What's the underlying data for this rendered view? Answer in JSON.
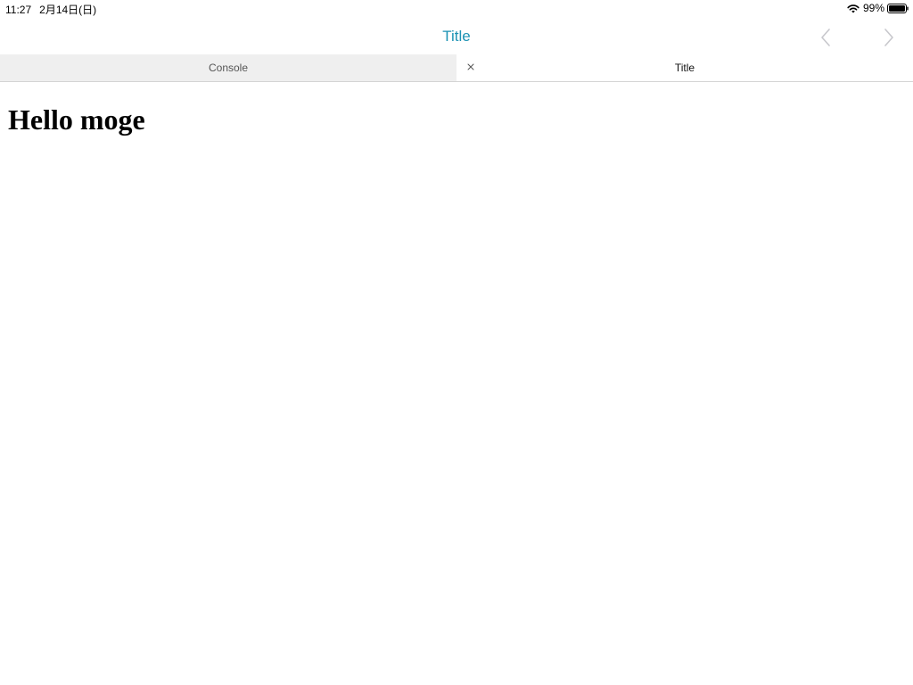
{
  "status_bar": {
    "time": "11:27",
    "date": "2月14日(日)",
    "battery_text": "99%"
  },
  "nav_bar": {
    "title": "Title",
    "title_color": "#1d93b4",
    "back_icon": "chevron-left-icon",
    "forward_icon": "chevron-right-icon"
  },
  "tabs": [
    {
      "label": "Console",
      "active": false
    },
    {
      "label": "Title",
      "active": true,
      "close_icon": "close-icon"
    }
  ],
  "content": {
    "heading": "Hello moge"
  }
}
